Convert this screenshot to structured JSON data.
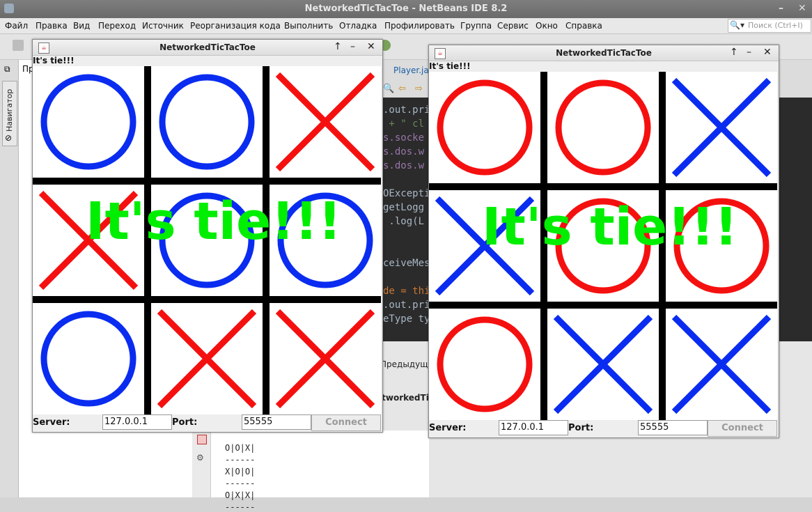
{
  "ide": {
    "title": "NetworkedTicTacToe - NetBeans IDE 8.2",
    "menu": [
      "Файл",
      "Правка",
      "Вид",
      "Переход",
      "Источник",
      "Реорганизация кода",
      "Выполнить",
      "Отладка",
      "Профилировать",
      "Группа",
      "Сервис",
      "Окно",
      "Справка"
    ],
    "search_placeholder": "Поиск (Ctrl+I)",
    "navigator_tab": "Навигатор",
    "project_tab_partial": "Пр",
    "editor_tab": "Player.java",
    "code_lines": [
      {
        "text": ".out.pri",
        "color": "#a9b7c6"
      },
      {
        "text": " + \" cl",
        "color": "#6a8759"
      },
      {
        "text": "s.socke",
        "color": "#9876aa"
      },
      {
        "text": "s.dos.w",
        "color": "#9876aa"
      },
      {
        "text": "s.dos.w",
        "color": "#9876aa"
      },
      {
        "text": "",
        "color": "#a9b7c6"
      },
      {
        "text": "OExcepti",
        "color": "#a9b7c6"
      },
      {
        "text": "getLogg",
        "color": "#a9b7c6"
      },
      {
        "text": " .log(L",
        "color": "#a9b7c6"
      },
      {
        "text": "",
        "color": "#a9b7c6"
      },
      {
        "text": "",
        "color": "#a9b7c6"
      },
      {
        "text": "ceiveMes",
        "color": "#a9b7c6"
      },
      {
        "text": "",
        "color": "#a9b7c6"
      },
      {
        "text": "de = thi",
        "color": "#cc7832"
      },
      {
        "text": ".out.pri",
        "color": "#a9b7c6"
      },
      {
        "text": "eType ty",
        "color": "#a9b7c6"
      }
    ],
    "prev_link": "Предыдущ",
    "output_tab": "etworkedTic",
    "output_lines": [
      "O|O|X|",
      "------",
      "X|O|O|",
      "------",
      "O|X|X|",
      "------"
    ]
  },
  "windows": [
    {
      "title": "NetworkedTicTacToe",
      "status": "It's tie!!!",
      "overlay": "It's tie!!!",
      "board": [
        "O",
        "O",
        "X",
        "X",
        "O",
        "O",
        "O",
        "X",
        "X"
      ],
      "o_color": "#0a2cf0",
      "x_color": "#f51010",
      "server_label": "Server:",
      "server_value": "127.0.0.1",
      "port_label": "Port:",
      "port_value": "55555",
      "connect_label": "Connect"
    },
    {
      "title": "NetworkedTicTacToe",
      "status": "It's tie!!!",
      "overlay": "It's tie!!!",
      "board": [
        "O",
        "O",
        "X",
        "X",
        "O",
        "O",
        "O",
        "X",
        "X"
      ],
      "o_color": "#f51010",
      "x_color": "#0a2cf0",
      "server_label": "Server:",
      "server_value": "127.0.0.1",
      "port_label": "Port:",
      "port_value": "55555",
      "connect_label": "Connect"
    }
  ]
}
